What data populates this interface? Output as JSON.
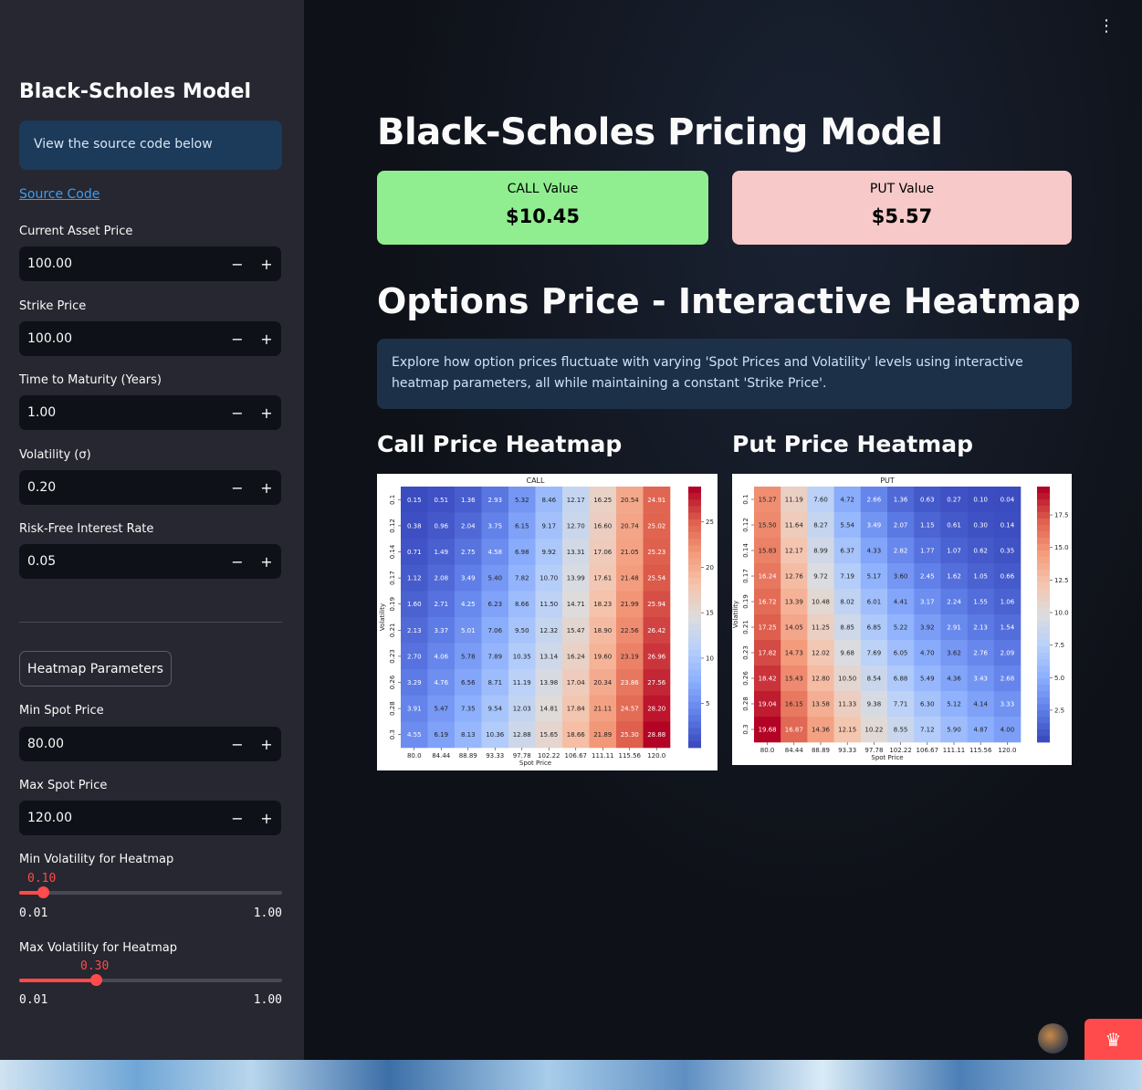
{
  "sidebar": {
    "title": "Black-Scholes Model",
    "info": "View the source code below",
    "source_link": "Source Code",
    "inputs": [
      {
        "label": "Current Asset Price",
        "value": "100.00"
      },
      {
        "label": "Strike Price",
        "value": "100.00"
      },
      {
        "label": "Time to Maturity (Years)",
        "value": "1.00"
      },
      {
        "label": "Volatility (σ)",
        "value": "0.20"
      },
      {
        "label": "Risk-Free Interest Rate",
        "value": "0.05"
      }
    ],
    "heatmap_button": "Heatmap Parameters",
    "spot_inputs": [
      {
        "label": "Min Spot Price",
        "value": "80.00"
      },
      {
        "label": "Max Spot Price",
        "value": "120.00"
      }
    ],
    "minus": "−",
    "plus": "+",
    "sliders": [
      {
        "label": "Min Volatility for Heatmap",
        "value": "0.10",
        "fraction": 0.0909,
        "min": "0.01",
        "max": "1.00"
      },
      {
        "label": "Max Volatility for Heatmap",
        "value": "0.30",
        "fraction": 0.2929,
        "min": "0.01",
        "max": "1.00"
      }
    ]
  },
  "main": {
    "menu_icon": "⋮",
    "title": "Black-Scholes Pricing Model",
    "call": {
      "label": "CALL Value",
      "value": "$10.45",
      "color": "#90ee90"
    },
    "put": {
      "label": "PUT Value",
      "value": "$5.57",
      "color": "#f7c9c9"
    },
    "heatmap_title": "Options Price - Interactive Heatmap",
    "description": "Explore how option prices fluctuate with varying 'Spot Prices and Volatility' levels using interactive heatmap parameters, all while maintaining a constant 'Strike Price'.",
    "call_heading": "Call Price Heatmap",
    "put_heading": "Put Price Heatmap"
  },
  "chart_data": [
    {
      "type": "heatmap",
      "title": "CALL",
      "xlabel": "Spot Price",
      "ylabel": "Volatility",
      "x": [
        "80.0",
        "84.44",
        "88.89",
        "93.33",
        "97.78",
        "102.22",
        "106.67",
        "111.11",
        "115.56",
        "120.0"
      ],
      "y": [
        "0.1",
        "0.12",
        "0.14",
        "0.17",
        "0.19",
        "0.21",
        "0.23",
        "0.26",
        "0.28",
        "0.3"
      ],
      "values": [
        [
          "0.15",
          "0.51",
          "1.36",
          "2.93",
          "5.32",
          "8.46",
          "12.17",
          "16.25",
          "20.54",
          "24.91"
        ],
        [
          "0.38",
          "0.96",
          "2.04",
          "3.75",
          "6.15",
          "9.17",
          "12.70",
          "16.60",
          "20.74",
          "25.02"
        ],
        [
          "0.71",
          "1.49",
          "2.75",
          "4.58",
          "6.98",
          "9.92",
          "13.31",
          "17.06",
          "21.05",
          "25.23"
        ],
        [
          "1.12",
          "2.08",
          "3.49",
          "5.40",
          "7.82",
          "10.70",
          "13.99",
          "17.61",
          "21.48",
          "25.54"
        ],
        [
          "1.60",
          "2.71",
          "4.25",
          "6.23",
          "8.66",
          "11.50",
          "14.71",
          "18.23",
          "21.99",
          "25.94"
        ],
        [
          "2.13",
          "3.37",
          "5.01",
          "7.06",
          "9.50",
          "12.32",
          "15.47",
          "18.90",
          "22.56",
          "26.42"
        ],
        [
          "2.70",
          "4.06",
          "5.78",
          "7.89",
          "10.35",
          "13.14",
          "16.24",
          "19.60",
          "23.19",
          "26.96"
        ],
        [
          "3.29",
          "4.76",
          "6.56",
          "8.71",
          "11.19",
          "13.98",
          "17.04",
          "20.34",
          "23.86",
          "27.56"
        ],
        [
          "3.91",
          "5.47",
          "7.35",
          "9.54",
          "12.03",
          "14.81",
          "17.84",
          "21.11",
          "24.57",
          "28.20"
        ],
        [
          "4.55",
          "6.19",
          "8.13",
          "10.36",
          "12.88",
          "15.65",
          "18.66",
          "21.89",
          "25.30",
          "28.88"
        ]
      ],
      "vmin": 0.15,
      "vmax": 28.88,
      "colorbar_ticks": [
        "5",
        "10",
        "15",
        "20",
        "25"
      ],
      "colormap": "coolwarm"
    },
    {
      "type": "heatmap",
      "title": "PUT",
      "xlabel": "Spot Price",
      "ylabel": "Volatility",
      "x": [
        "80.0",
        "84.44",
        "88.89",
        "93.33",
        "97.78",
        "102.22",
        "106.67",
        "111.11",
        "115.56",
        "120.0"
      ],
      "y": [
        "0.1",
        "0.12",
        "0.14",
        "0.17",
        "0.19",
        "0.21",
        "0.23",
        "0.26",
        "0.28",
        "0.3"
      ],
      "values": [
        [
          "15.27",
          "11.19",
          "7.60",
          "4.72",
          "2.66",
          "1.36",
          "0.63",
          "0.27",
          "0.10",
          "0.04"
        ],
        [
          "15.50",
          "11.64",
          "8.27",
          "5.54",
          "3.49",
          "2.07",
          "1.15",
          "0.61",
          "0.30",
          "0.14"
        ],
        [
          "15.83",
          "12.17",
          "8.99",
          "6.37",
          "4.33",
          "2.82",
          "1.77",
          "1.07",
          "0.62",
          "0.35"
        ],
        [
          "16.24",
          "12.76",
          "9.72",
          "7.19",
          "5.17",
          "3.60",
          "2.45",
          "1.62",
          "1.05",
          "0.66"
        ],
        [
          "16.72",
          "13.39",
          "10.48",
          "8.02",
          "6.01",
          "4.41",
          "3.17",
          "2.24",
          "1.55",
          "1.06"
        ],
        [
          "17.25",
          "14.05",
          "11.25",
          "8.85",
          "6.85",
          "5.22",
          "3.92",
          "2.91",
          "2.13",
          "1.54"
        ],
        [
          "17.82",
          "14.73",
          "12.02",
          "9.68",
          "7.69",
          "6.05",
          "4.70",
          "3.62",
          "2.76",
          "2.09"
        ],
        [
          "18.42",
          "15.43",
          "12.80",
          "10.50",
          "8.54",
          "6.88",
          "5.49",
          "4.36",
          "3.43",
          "2.68"
        ],
        [
          "19.04",
          "16.15",
          "13.58",
          "11.33",
          "9.38",
          "7.71",
          "6.30",
          "5.12",
          "4.14",
          "3.33"
        ],
        [
          "19.68",
          "16.87",
          "14.36",
          "12.15",
          "10.22",
          "8.55",
          "7.12",
          "5.90",
          "4.87",
          "4.00"
        ]
      ],
      "vmin": 0.04,
      "vmax": 19.68,
      "colorbar_ticks": [
        "2.5",
        "5.0",
        "7.5",
        "10.0",
        "12.5",
        "15.0",
        "17.5"
      ],
      "colormap": "coolwarm"
    }
  ]
}
